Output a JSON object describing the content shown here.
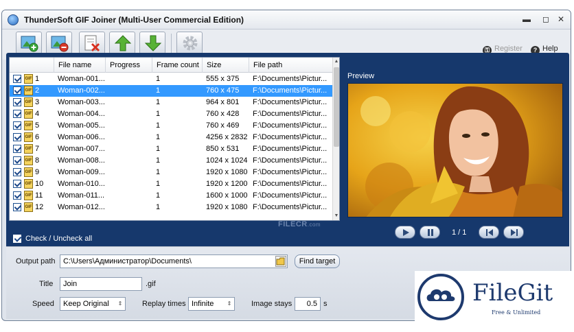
{
  "window": {
    "title": "ThunderSoft GIF Joiner (Multi-User Commercial Edition)",
    "controls": {
      "minimize": "▬",
      "maximize": "◻",
      "close": "✕"
    }
  },
  "toolbar": {
    "buttons": [
      {
        "name": "add-files-button",
        "icon": "image-add-icon"
      },
      {
        "name": "remove-file-button",
        "icon": "image-remove-icon"
      },
      {
        "name": "clear-list-button",
        "icon": "clear-list-icon"
      },
      {
        "name": "move-up-button",
        "icon": "arrow-up-icon"
      },
      {
        "name": "move-down-button",
        "icon": "arrow-down-icon"
      },
      {
        "name": "settings-button",
        "icon": "gear-icon"
      }
    ],
    "register_label": "Register",
    "help_label": "Help"
  },
  "file_list": {
    "columns": [
      "File name",
      "Progress",
      "Frame count",
      "Size",
      "File path"
    ],
    "rows": [
      {
        "num": "1",
        "name": "Woman-001...",
        "progress": "",
        "frames": "1",
        "size": "555 x 375",
        "path": "F:\\Documents\\Pictur...",
        "selected": false
      },
      {
        "num": "2",
        "name": "Woman-002...",
        "progress": "",
        "frames": "1",
        "size": "760 x 475",
        "path": "F:\\Documents\\Pictur...",
        "selected": true
      },
      {
        "num": "3",
        "name": "Woman-003...",
        "progress": "",
        "frames": "1",
        "size": "964 x 801",
        "path": "F:\\Documents\\Pictur...",
        "selected": false
      },
      {
        "num": "4",
        "name": "Woman-004...",
        "progress": "",
        "frames": "1",
        "size": "760 x 428",
        "path": "F:\\Documents\\Pictur...",
        "selected": false
      },
      {
        "num": "5",
        "name": "Woman-005...",
        "progress": "",
        "frames": "1",
        "size": "760 x 469",
        "path": "F:\\Documents\\Pictur...",
        "selected": false
      },
      {
        "num": "6",
        "name": "Woman-006...",
        "progress": "",
        "frames": "1",
        "size": "4256 x 2832",
        "path": "F:\\Documents\\Pictur...",
        "selected": false
      },
      {
        "num": "7",
        "name": "Woman-007...",
        "progress": "",
        "frames": "1",
        "size": "850 x 531",
        "path": "F:\\Documents\\Pictur...",
        "selected": false
      },
      {
        "num": "8",
        "name": "Woman-008...",
        "progress": "",
        "frames": "1",
        "size": "1024 x 1024",
        "path": "F:\\Documents\\Pictur...",
        "selected": false
      },
      {
        "num": "9",
        "name": "Woman-009...",
        "progress": "",
        "frames": "1",
        "size": "1920 x 1080",
        "path": "F:\\Documents\\Pictur...",
        "selected": false
      },
      {
        "num": "10",
        "name": "Woman-010...",
        "progress": "",
        "frames": "1",
        "size": "1920 x 1200",
        "path": "F:\\Documents\\Pictur...",
        "selected": false
      },
      {
        "num": "11",
        "name": "Woman-011...",
        "progress": "",
        "frames": "1",
        "size": "1600 x 1000",
        "path": "F:\\Documents\\Pictur...",
        "selected": false
      },
      {
        "num": "12",
        "name": "Woman-012...",
        "progress": "",
        "frames": "1",
        "size": "1920 x 1080",
        "path": "F:\\Documents\\Pictur...",
        "selected": false
      }
    ],
    "check_all_label": "Check / Uncheck all"
  },
  "watermark": {
    "main": "FILECR",
    "sub": ".com"
  },
  "preview": {
    "label": "Preview",
    "page_indicator": "1 / 1",
    "colors": {
      "panel": "#16386c",
      "image_bg": "#e3a51c"
    }
  },
  "output": {
    "path_label": "Output path",
    "path_value": "C:\\Users\\Администратор\\Documents\\",
    "find_target_label": "Find target",
    "title_label": "Title",
    "title_value": "Join",
    "title_ext": ".gif",
    "speed_label": "Speed",
    "speed_value": "Keep Original",
    "replay_label": "Replay times",
    "replay_value": "Infinite",
    "stays_label": "Image stays",
    "stays_value": "0.5",
    "stays_unit": "s"
  },
  "badge": {
    "name": "FileGit",
    "tagline": "Free & Unlimited",
    "color": "#1e3a6e"
  }
}
